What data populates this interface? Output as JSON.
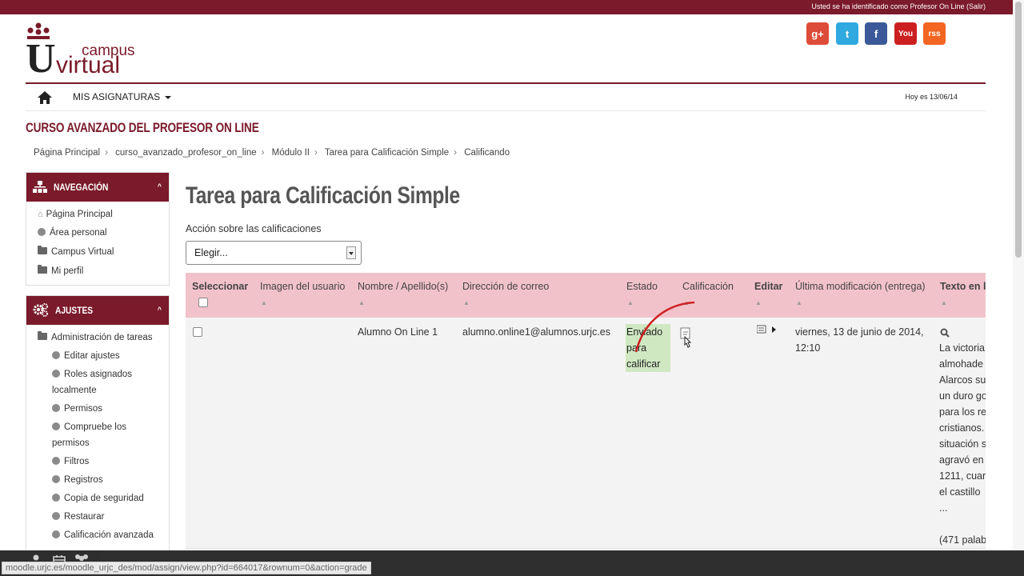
{
  "topbar": {
    "login_text": "Usted se ha identificado como Profesor On Line (Salir)"
  },
  "logo": {
    "letter": "U",
    "line1": "campus",
    "line2": "virtual"
  },
  "social": [
    {
      "icon": "google-plus-icon",
      "label": "g+",
      "color": "#dd4b39"
    },
    {
      "icon": "twitter-icon",
      "label": "t",
      "color": "#2fa9e0"
    },
    {
      "icon": "facebook-icon",
      "label": "f",
      "color": "#3b5998"
    },
    {
      "icon": "youtube-icon",
      "label": "You",
      "color": "#cc2020"
    },
    {
      "icon": "rss-icon",
      "label": "rss",
      "color": "#f26522"
    }
  ],
  "navbar": {
    "menu_label": "MIS ASIGNATURAS",
    "date_text": "Hoy es 13/06/14"
  },
  "course_title": "CURSO AVANZADO DEL PROFESOR ON LINE",
  "breadcrumb": [
    "Página Principal",
    "curso_avanzado_profesor_on_line",
    "Módulo II",
    "Tarea para Calificación Simple",
    "Calificando"
  ],
  "nav_block": {
    "title": "NAVEGACIÓN",
    "items": [
      "Página Principal",
      "Área personal",
      "Campus Virtual",
      "Mi perfil"
    ]
  },
  "settings_block": {
    "title": "AJUSTES",
    "section": "Administración de tareas",
    "items": [
      "Editar ajustes",
      "Roles asignados",
      "localmente",
      "Permisos",
      "Compruebe los",
      "permisos",
      "Filtros",
      "Registros",
      "Copia de seguridad",
      "Restaurar",
      "Calificación avanzada"
    ]
  },
  "page": {
    "heading": "Tarea para Calificación Simple",
    "action_label": "Acción sobre las calificaciones",
    "select_value": "Elegir..."
  },
  "table": {
    "headers": [
      "Seleccionar",
      "Imagen del usuario",
      "Nombre / Apellido(s)",
      "Dirección de correo",
      "Estado",
      "Calificación",
      "Editar",
      "Última modificación (entrega)",
      "Texto en l"
    ],
    "row": {
      "name": "Alumno On Line 1",
      "email": "alumno.online1@alumnos.urjc.es",
      "status_lines": [
        "Enviado",
        "para",
        "calificar"
      ],
      "modified_lines": [
        "viernes, 13 de junio de 2014,",
        "12:10"
      ],
      "text_lines": [
        "La victoria",
        "almohade",
        "Alarcos su",
        "un duro go",
        "para los re",
        "cristianos.",
        "situación s",
        "agravó en",
        "1211, cuar",
        "el castillo",
        "...",
        "",
        "(471 palab"
      ]
    }
  },
  "status_url": "moodle.urjc.es/moodle_urjc_des/mod/assign/view.php?id=664017&rownum=0&action=grade"
}
